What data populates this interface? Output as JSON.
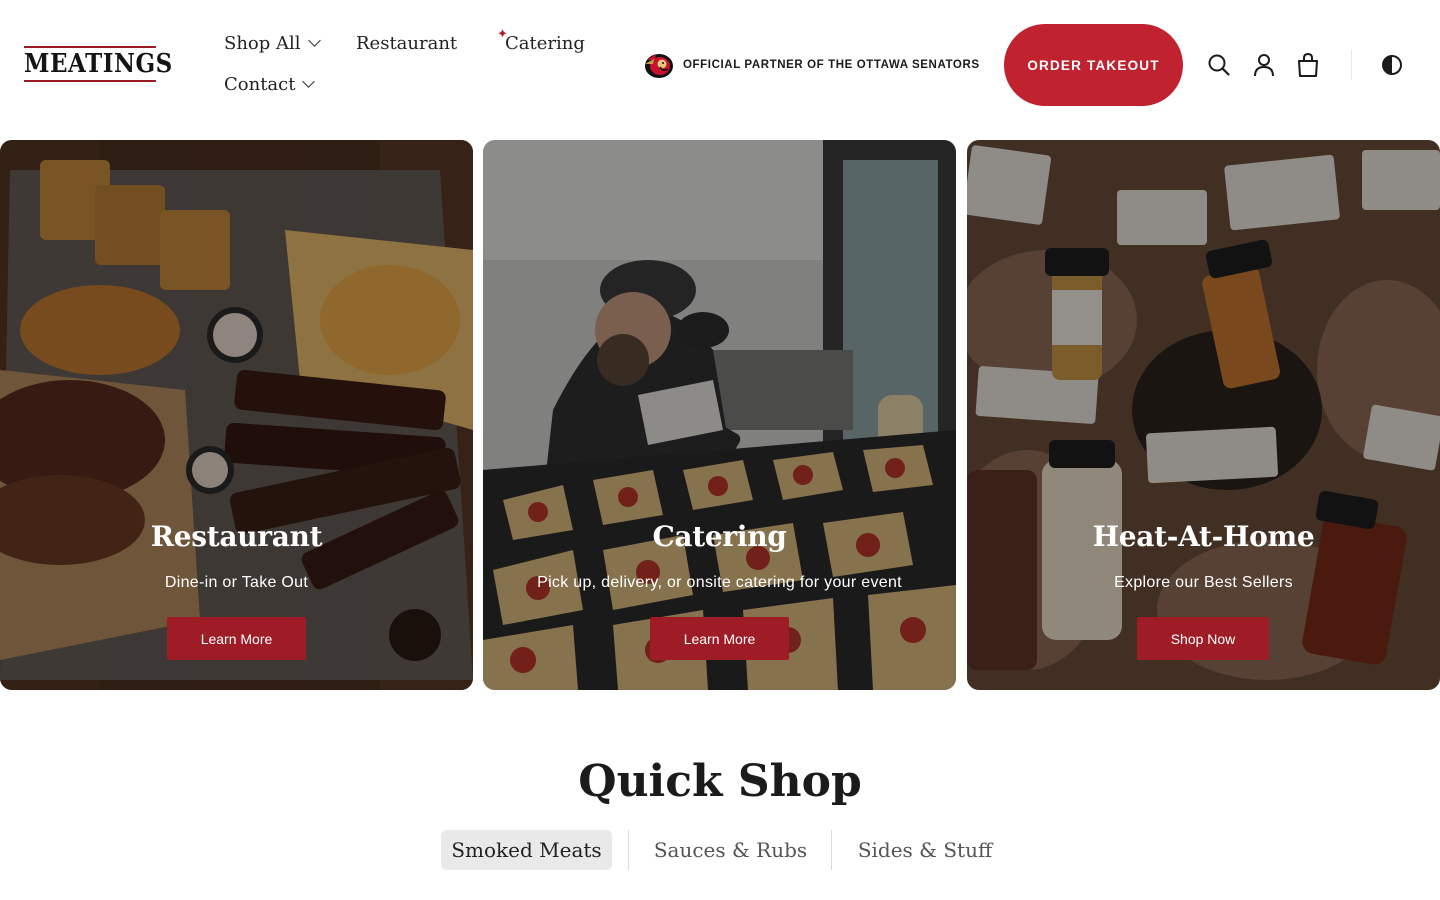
{
  "brand": {
    "logo_text": "MEATINGS",
    "accent": "#c0232f",
    "button_dark": "#9d1c26"
  },
  "nav": {
    "shop_all": "Shop All",
    "restaurant": "Restaurant",
    "catering": "Catering",
    "contact": "Contact",
    "sparkle": "✦"
  },
  "partner": {
    "text": "OFFICIAL PARTNER OF THE OTTAWA SENATORS",
    "icon": "ottawa-senators-logo"
  },
  "header": {
    "order_label": "ORDER TAKEOUT"
  },
  "icons": [
    "search-icon",
    "account-icon",
    "bag-icon",
    "contrast-icon"
  ],
  "cards": [
    {
      "title": "Restaurant",
      "subtitle": "Dine-in or Take Out",
      "button": "Learn More"
    },
    {
      "title": "Catering",
      "subtitle": "Pick up, delivery, or onsite catering for your event",
      "button": "Learn More"
    },
    {
      "title": "Heat-At-Home",
      "subtitle": "Explore our Best Sellers",
      "button": "Shop Now"
    }
  ],
  "quick_shop": {
    "title": "Quick Shop",
    "tabs": [
      "Smoked Meats",
      "Sauces & Rubs",
      "Sides & Stuff"
    ],
    "active_tab": "Smoked Meats"
  }
}
